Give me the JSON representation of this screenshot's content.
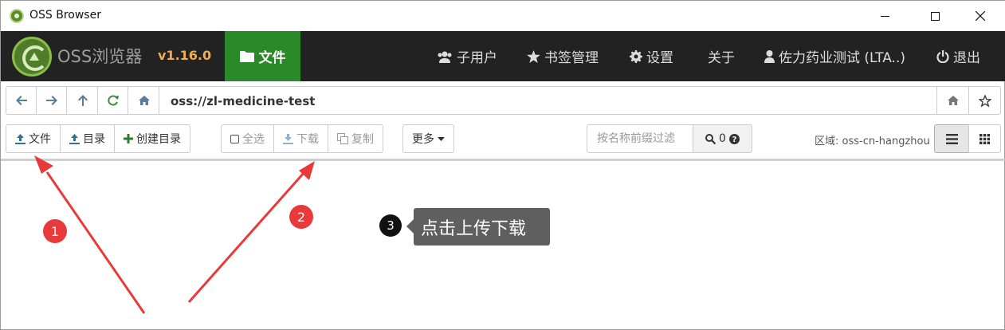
{
  "window": {
    "title": "OSS Browser"
  },
  "navbar": {
    "brand": "OSS浏览器",
    "version": "v1.16.0",
    "files_tab": "文件",
    "items": {
      "subusers": "子用户",
      "bookmarks": "书签管理",
      "settings": "设置",
      "about": "关于",
      "account": "佐力药业测试 (LTA..)",
      "logout": "退出"
    }
  },
  "address": {
    "path": "oss://zl-medicine-test"
  },
  "toolbar": {
    "upload_file": "文件",
    "upload_dir": "目录",
    "create_dir": "创建目录",
    "select_all": "全选",
    "download": "下载",
    "copy": "复制",
    "more": "更多",
    "filter_placeholder": "按名称前缀过滤",
    "search_count": "0",
    "region": "区域: oss-cn-hangzhou"
  },
  "annotations": {
    "badge1": "1",
    "badge2": "2",
    "badge3": "3",
    "tooltip": "点击上传下载"
  },
  "colors": {
    "navbar_bg": "#222222",
    "active_tab": "#2a8a2a",
    "version": "#f0ad4e",
    "annotation_red": "#e83a3a"
  }
}
